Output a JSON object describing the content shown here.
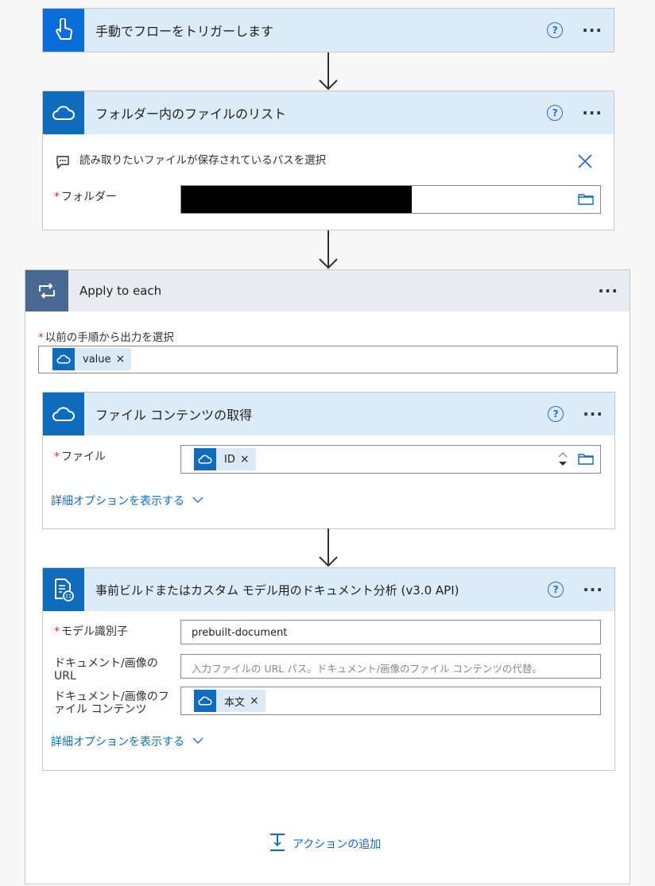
{
  "cards": {
    "trigger": {
      "title": "手動でフローをトリガーします",
      "help": "?",
      "more": "···"
    },
    "list_files": {
      "title": "フォルダー内のファイルのリスト",
      "help": "?",
      "more": "···",
      "comment": "読み取りたいファイルが保存されているパスを選択",
      "folder_label": "フォルダー",
      "required_mark": "*"
    },
    "apply_each": {
      "title": "Apply to each",
      "more": "···",
      "select_label": "以前の手順から出力を選択",
      "required_mark": "*",
      "token": "value",
      "token_remove": "×",
      "add_action": "アクションの追加"
    },
    "get_content": {
      "title": "ファイル コンテンツの取得",
      "help": "?",
      "more": "···",
      "file_label": "ファイル",
      "required_mark": "*",
      "token": "ID",
      "token_remove": "×",
      "advanced": "詳細オプションを表示する"
    },
    "analyze": {
      "title": "事前ビルドまたはカスタム モデル用のドキュメント分析 (v3.0 API)",
      "help": "?",
      "more": "···",
      "model_label": "モデル識別子",
      "required_mark": "*",
      "model_value": "prebuilt-document",
      "url_label_1": "ドキュメント/画像の",
      "url_label_2": "URL",
      "url_placeholder": "入力ファイルの URL パス。ドキュメント/画像のファイル コンテンツの代替。",
      "content_label_1": "ドキュメント/画像のフ",
      "content_label_2": "ァイル コンテンツ",
      "token": "本文",
      "token_remove": "×",
      "advanced": "詳細オプションを表示する"
    }
  },
  "icons": {
    "trigger": "touch-hand-icon",
    "onedrive": "onedrive-cloud-icon",
    "loop": "loop-icon",
    "document": "document-analysis-icon",
    "folder": "folder-icon",
    "comment": "comment-icon",
    "close": "close-icon",
    "chevron": "chevron-down-icon",
    "add": "add-action-icon",
    "arrow": "arrow-down-icon"
  },
  "colors": {
    "header_bg": "#dcebf8",
    "trigger_blue": "#0b6ed8",
    "onedrive_blue": "#0f6cbd",
    "loop_slate": "#486991",
    "link_blue": "#0f6cbd",
    "required_red": "#d13438"
  }
}
